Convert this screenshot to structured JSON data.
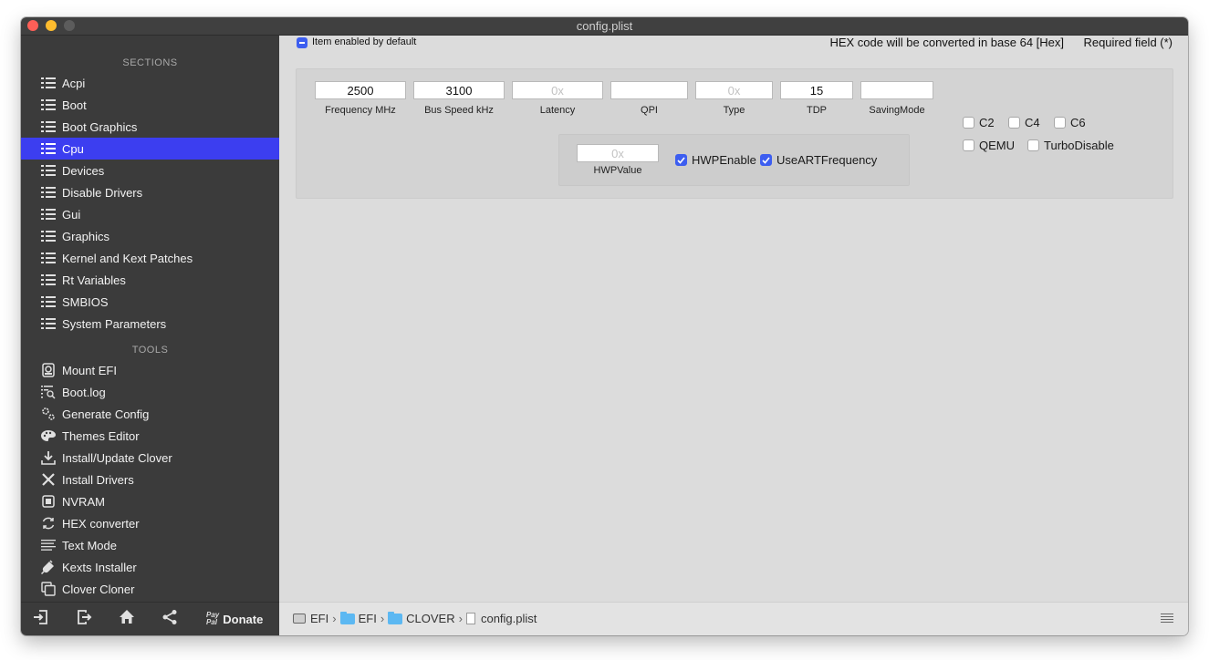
{
  "window": {
    "title": "config.plist"
  },
  "sidebar": {
    "sections_header": "SECTIONS",
    "sections": [
      {
        "label": "Acpi",
        "icon": "list-icon"
      },
      {
        "label": "Boot",
        "icon": "list-icon"
      },
      {
        "label": "Boot Graphics",
        "icon": "list-icon"
      },
      {
        "label": "Cpu",
        "icon": "list-icon",
        "selected": true
      },
      {
        "label": "Devices",
        "icon": "list-icon"
      },
      {
        "label": "Disable Drivers",
        "icon": "list-icon"
      },
      {
        "label": "Gui",
        "icon": "list-icon"
      },
      {
        "label": "Graphics",
        "icon": "list-icon"
      },
      {
        "label": "Kernel and Kext Patches",
        "icon": "list-icon"
      },
      {
        "label": "Rt Variables",
        "icon": "list-icon"
      },
      {
        "label": "SMBIOS",
        "icon": "list-icon"
      },
      {
        "label": "System Parameters",
        "icon": "list-icon"
      }
    ],
    "tools_header": "TOOLS",
    "tools": [
      {
        "label": "Mount EFI",
        "icon": "disk-icon"
      },
      {
        "label": "Boot.log",
        "icon": "log-search-icon"
      },
      {
        "label": "Generate Config",
        "icon": "gears-icon"
      },
      {
        "label": "Themes Editor",
        "icon": "palette-icon"
      },
      {
        "label": "Install/Update Clover",
        "icon": "download-icon"
      },
      {
        "label": "Install Drivers",
        "icon": "tools-icon"
      },
      {
        "label": "NVRAM",
        "icon": "chip-icon"
      },
      {
        "label": "HEX converter",
        "icon": "refresh-icon"
      },
      {
        "label": "Text Mode",
        "icon": "text-lines-icon"
      },
      {
        "label": "Kexts Installer",
        "icon": "plug-icon"
      },
      {
        "label": "Clover Cloner",
        "icon": "clone-icon"
      }
    ],
    "bottom": {
      "paypal_line1": "Pay",
      "paypal_line2": "Pal",
      "donate_label": "Donate"
    }
  },
  "header": {
    "enabled_label": "Item enabled by default",
    "enabled_checked": true,
    "hex_note": "HEX code will be converted in base 64 [Hex]",
    "required_note": "Required field (*)"
  },
  "cpu": {
    "fields": [
      {
        "label": "Frequency MHz",
        "value": "2500",
        "placeholder": ""
      },
      {
        "label": "Bus Speed kHz",
        "value": "3100",
        "placeholder": ""
      },
      {
        "label": "Latency",
        "value": "",
        "placeholder": "0x"
      },
      {
        "label": "QPI",
        "value": "",
        "placeholder": ""
      },
      {
        "label": "Type",
        "value": "",
        "placeholder": "0x"
      },
      {
        "label": "TDP",
        "value": "15",
        "placeholder": ""
      },
      {
        "label": "SavingMode",
        "value": "",
        "placeholder": ""
      }
    ],
    "hwp_value": {
      "label": "HWPValue",
      "value": "",
      "placeholder": "0x"
    },
    "checkboxes_inner": [
      {
        "label": "HWPEnable",
        "checked": true
      },
      {
        "label": "UseARTFrequency",
        "checked": true
      }
    ],
    "checkboxes_right": [
      {
        "label": "C2",
        "checked": false
      },
      {
        "label": "C4",
        "checked": false
      },
      {
        "label": "C6",
        "checked": false
      },
      {
        "label": "QEMU",
        "checked": false
      },
      {
        "label": "TurboDisable",
        "checked": false
      }
    ]
  },
  "statusbar": {
    "path": [
      "EFI",
      "EFI",
      "CLOVER",
      "config.plist"
    ],
    "separator": "›"
  },
  "colors": {
    "accent": "#3c3ef0",
    "sidebar_bg": "#3b3b3b",
    "checkbox_blue": "#3d5ef0"
  }
}
